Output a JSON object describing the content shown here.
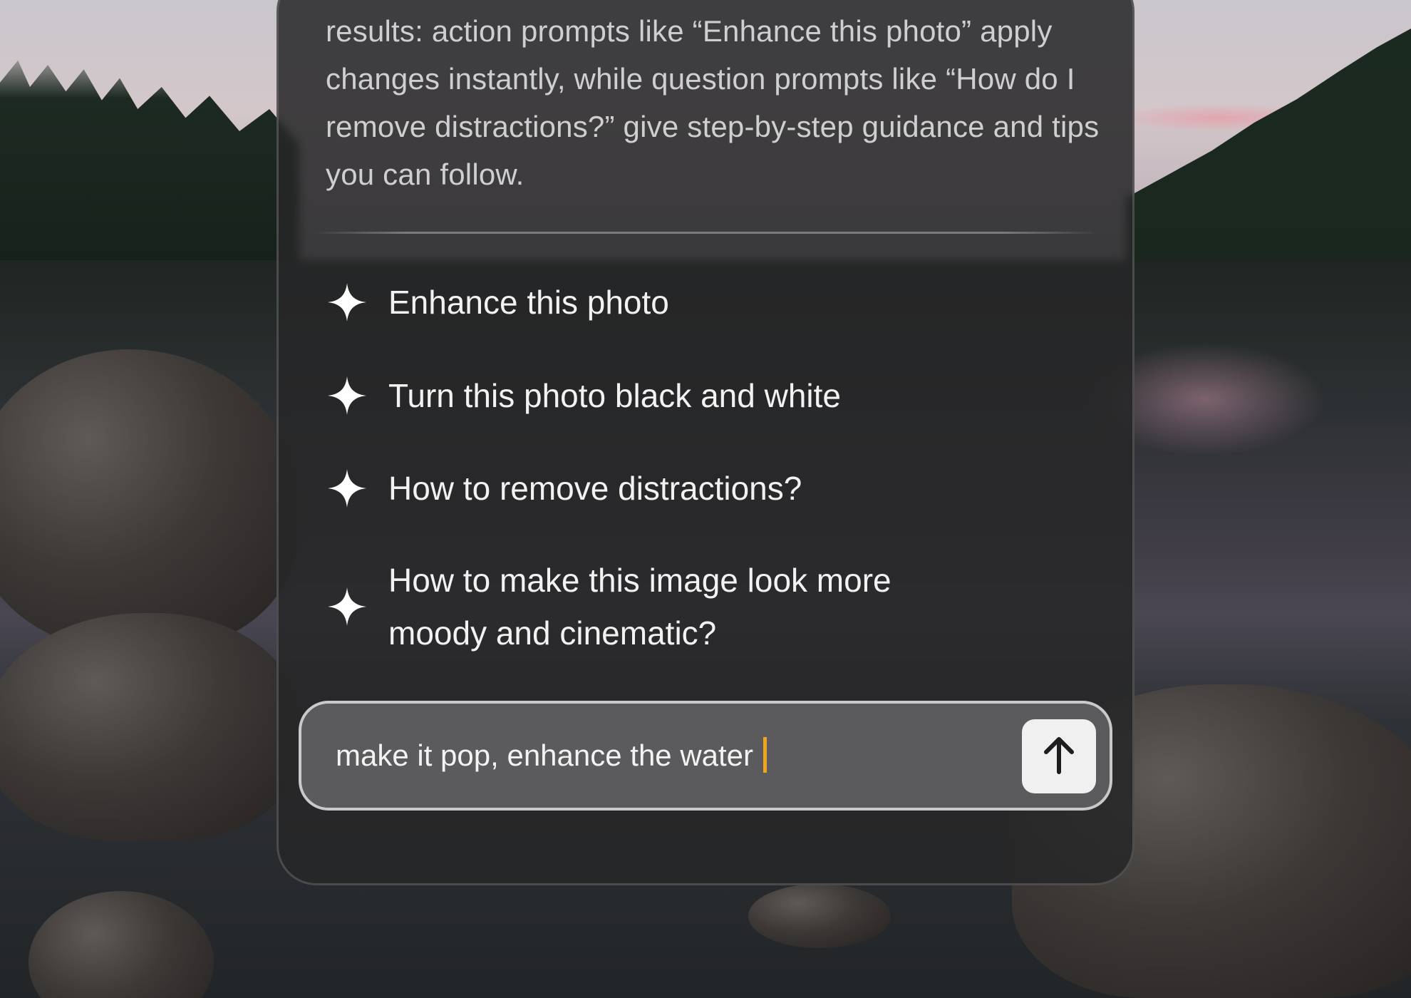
{
  "assistant": {
    "intro_text": "results: action prompts like “Enhance this photo” apply changes instantly, while question prompts like “How do I remove distractions?” give step-by-step guidance and tips you can follow."
  },
  "suggestions": [
    {
      "label": "Enhance this photo",
      "icon": "sparkle-icon"
    },
    {
      "label": "Turn this photo black and white",
      "icon": "sparkle-icon"
    },
    {
      "label": "How to remove distractions?",
      "icon": "sparkle-icon"
    },
    {
      "label": "How to make this image look more moody and cinematic?",
      "icon": "sparkle-icon"
    }
  ],
  "prompt_input": {
    "value": "make it pop, enhance the water",
    "caret_color": "#f0a521"
  },
  "send_button": {
    "icon": "arrow-up-icon"
  },
  "colors": {
    "panel": "#262628",
    "input_bg": "#5b5b5d",
    "input_border": "#c9c9cc",
    "text": "#f2f2f3"
  }
}
